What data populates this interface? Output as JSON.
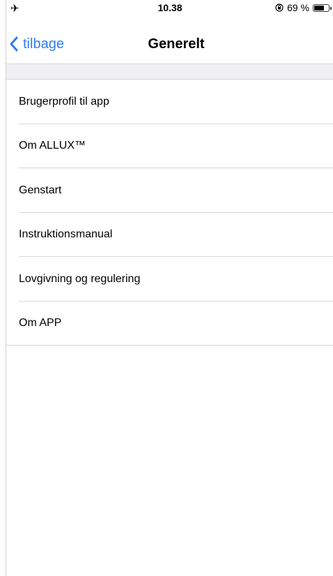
{
  "status_bar": {
    "left_icon": "airplane-icon",
    "time": "10.38",
    "right_icon": "orientation-lock-icon",
    "battery_percent": "69 %",
    "battery_level": 0.69
  },
  "nav": {
    "back_label": "tilbage",
    "title": "Generelt",
    "accent_color": "#2f7cf6"
  },
  "menu": {
    "items": [
      {
        "label": "Brugerprofil til app"
      },
      {
        "label": "Om ALLUX™"
      },
      {
        "label": "Genstart"
      },
      {
        "label": "Instruktionsmanual"
      },
      {
        "label": "Lovgivning og regulering"
      },
      {
        "label": "Om APP"
      }
    ]
  }
}
